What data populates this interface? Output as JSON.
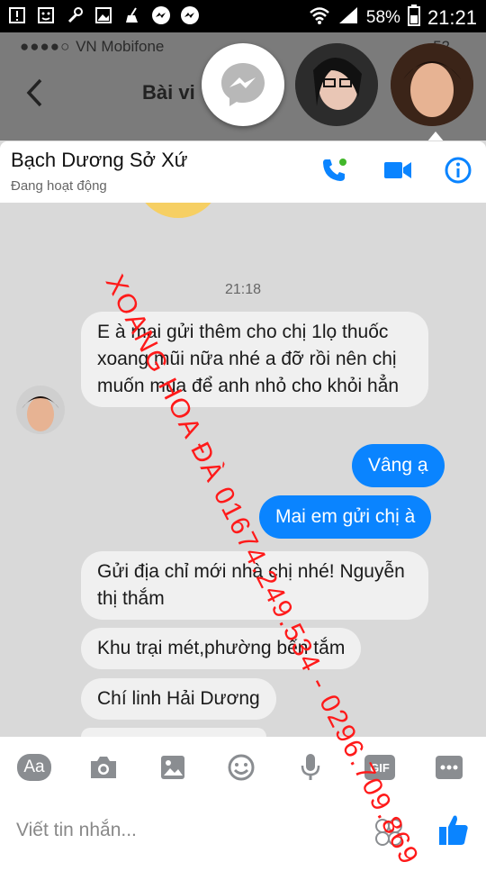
{
  "statusbar": {
    "battery": "58%",
    "time": "21:21"
  },
  "background_app": {
    "carrier": "VN Mobifone",
    "title": "Bài vi",
    "battery": "52"
  },
  "header": {
    "contact_name": "Bạch Dương Sở Xứ",
    "status": "Đang hoạt động"
  },
  "timestamp": "21:18",
  "messages": [
    {
      "dir": "in",
      "text": "E à mai gửi thêm cho chị 1lọ thuốc xoang mũi nữa nhé a đỡ rồi nên chị muốn mua để anh nhỏ cho khỏi hẳn"
    },
    {
      "dir": "out",
      "text": "Vâng ạ"
    },
    {
      "dir": "out",
      "text": "Mai em gửi chị à"
    },
    {
      "dir": "in",
      "text": "Gửi địa chỉ mới nhà chị nhé! Nguyễn thị thắm"
    },
    {
      "dir": "in",
      "text": "Khu trại mét,phường bến tắm"
    },
    {
      "dir": "in",
      "text": "Chí linh Hải Dương"
    }
  ],
  "toolbar": {
    "aa_label": "Aa",
    "gif_label": "GIF"
  },
  "composer": {
    "placeholder": "Viết tin nhắn..."
  },
  "watermark": "XOANG HOA ĐÀ 01674.249.534 - 0296.709.869",
  "colors": {
    "accent": "#0a84ff",
    "watermark": "#ff1a1a",
    "chat_bg": "#d9d9d9"
  }
}
